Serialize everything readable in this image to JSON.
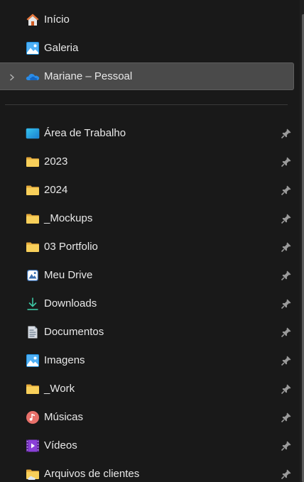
{
  "top_items": [
    {
      "label": "Início",
      "icon": "home-icon"
    },
    {
      "label": "Galeria",
      "icon": "gallery-icon"
    },
    {
      "label": "Mariane – Pessoal",
      "icon": "onedrive-cloud-icon",
      "selected": true
    }
  ],
  "pinned_items": [
    {
      "label": "Área de Trabalho",
      "icon": "desktop-icon"
    },
    {
      "label": "2023",
      "icon": "folder-icon"
    },
    {
      "label": "2024",
      "icon": "folder-icon"
    },
    {
      "label": "_Mockups",
      "icon": "folder-icon"
    },
    {
      "label": "03 Portfolio",
      "icon": "folder-icon"
    },
    {
      "label": "Meu Drive",
      "icon": "drive-icon"
    },
    {
      "label": "Downloads",
      "icon": "download-icon"
    },
    {
      "label": "Documentos",
      "icon": "documents-icon"
    },
    {
      "label": "Imagens",
      "icon": "pictures-icon"
    },
    {
      "label": "_Work",
      "icon": "folder-icon"
    },
    {
      "label": "Músicas",
      "icon": "music-icon"
    },
    {
      "label": "Vídeos",
      "icon": "videos-icon"
    },
    {
      "label": "Arquivos de clientes",
      "icon": "shared-folder-icon"
    }
  ],
  "colors": {
    "background": "#191919",
    "selected_background": "#4a4a4a",
    "text": "#e8e8e8",
    "folder_yellow": "#f8cf5a",
    "pin_gray": "#9a9a9a"
  }
}
